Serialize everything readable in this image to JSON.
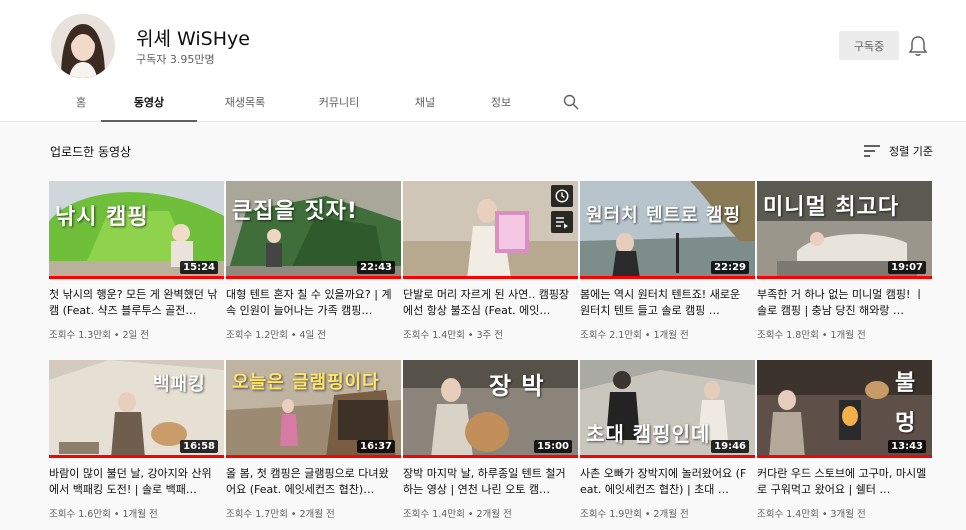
{
  "channel": {
    "name": "위셰 WiSHye",
    "subscribers": "구독자 3.95만명",
    "subscribe_label": "구독중"
  },
  "tabs": [
    "홈",
    "동영상",
    "재생목록",
    "커뮤니티",
    "채널",
    "정보"
  ],
  "active_tab": "동영상",
  "section": {
    "title": "업로드한 동영상",
    "sort_label": "정렬 기준"
  },
  "colors": {
    "progress": "#ff0000",
    "accent_text": "#0f0f0f",
    "secondary_text": "#606060"
  },
  "videos": [
    {
      "title": "첫 낚시의 행운? 모든 게 완벽했던 낚캠 (Feat. 샥즈 블루투스 골전…",
      "views": "조회수 1.3만회",
      "age": "2일 전",
      "duration": "15:24",
      "thumb_text": "낚시 캠핑",
      "watched": 1.0
    },
    {
      "title": "대형 텐트 혼자 칠 수 있을까요? | 계속 인원이 늘어나는 가족 캠핑…",
      "views": "조회수 1.2만회",
      "age": "4일 전",
      "duration": "22:43",
      "thumb_text": "큰집을 짓자!",
      "watched": 1.0
    },
    {
      "title": "단발로 머리 자르게 된 사연.. 캠핑장에선 항상 불조심 (Feat. 에잇…",
      "views": "조회수 1.4만회",
      "age": "3주 전",
      "duration": "",
      "thumb_text": "",
      "watched": 1.0
    },
    {
      "title": "봄에는 역시 원터치 텐트죠! 새로운 원터치 텐트 들고 솔로 캠핑 …",
      "views": "조회수 2.1만회",
      "age": "1개월 전",
      "duration": "22:29",
      "thumb_text": "원터치 텐트로 캠핑",
      "watched": 1.0
    },
    {
      "title": "부족한 거 하나 없는 미니멀 캠핑! ㅣ솔로 캠핑 | 충남 당진 해와랑 …",
      "views": "조회수 1.8만회",
      "age": "1개월 전",
      "duration": "19:07",
      "thumb_text": "미니멀 최고다",
      "watched": 1.0
    },
    {
      "title": "바람이 많이 불던 날, 강아지와 산위에서 백패킹 도전! | 솔로 백패…",
      "views": "조회수 1.6만회",
      "age": "1개월 전",
      "duration": "16:58",
      "thumb_text": "백패킹",
      "watched": 1.0
    },
    {
      "title": "올 봄, 첫 캠핑은 글램핑으로 다녀왔어요 (Feat. 에잇세컨즈 협찬)…",
      "views": "조회수 1.7만회",
      "age": "2개월 전",
      "duration": "16:37",
      "thumb_text": "오늘은 글램핑이다",
      "watched": 1.0
    },
    {
      "title": "장박 마지막 날, 하루종일 텐트 철거하는 영상 | 연천 나린 오토 캠…",
      "views": "조회수 1.4만회",
      "age": "2개월 전",
      "duration": "15:00",
      "thumb_text": "장 박",
      "watched": 1.0
    },
    {
      "title": "사촌 오빠가 장박지에 놀러왔어요 (Feat. 에잇세컨즈 협찬) | 초대 …",
      "views": "조회수 1.9만회",
      "age": "2개월 전",
      "duration": "19:46",
      "thumb_text": "초대 캠핑인데",
      "watched": 1.0
    },
    {
      "title": "커다란 우드 스토브에 고구마, 마시멜로 구워먹고 왔어요 | 쉘터 …",
      "views": "조회수 1.4만회",
      "age": "3개월 전",
      "duration": "13:43",
      "thumb_text": "불멍",
      "watched": 1.0
    }
  ]
}
